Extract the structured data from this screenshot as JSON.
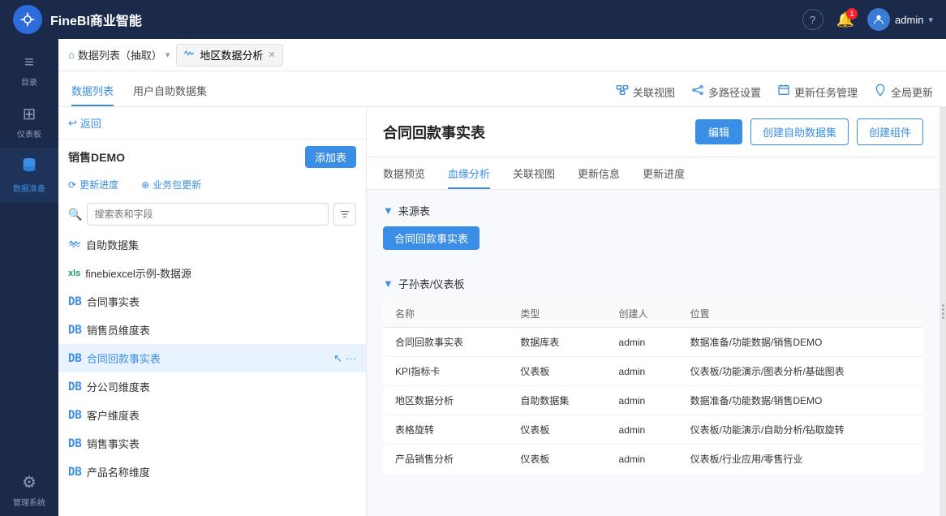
{
  "app": {
    "title": "FineBI商业智能",
    "logo_symbol": "⊕"
  },
  "topnav": {
    "help_icon": "?",
    "notif_count": "1",
    "admin_label": "admin",
    "admin_arrow": "▾"
  },
  "breadcrumb": {
    "home_icon": "⌂",
    "home_label": "数据列表（抽取）",
    "dropdown_icon": "▾",
    "wave_icon": "∿",
    "tab_label": "地区数据分析",
    "close_icon": "✕"
  },
  "sub_tabs": [
    {
      "label": "数据列表",
      "active": true
    },
    {
      "label": "用户自助数据集",
      "active": false
    }
  ],
  "sub_actions": [
    {
      "icon": "📊",
      "label": "关联视图"
    },
    {
      "icon": "⑆",
      "label": "多路径设置"
    },
    {
      "icon": "☁",
      "label": "更新任务管理"
    },
    {
      "icon": "☁",
      "label": "全局更新"
    }
  ],
  "left_panel": {
    "back_label": "↩ 返回",
    "demo_title": "销售DEMO",
    "add_btn_label": "添加表",
    "update_progress_icon": "⟳",
    "update_progress_label": "更新进度",
    "biz_update_icon": "+",
    "biz_update_label": "业务包更新",
    "search_placeholder": "搜索表和字段",
    "tree_items": [
      {
        "type": "self",
        "icon": "∿∿",
        "label": "自助数据集",
        "active": false
      },
      {
        "type": "xls",
        "icon": "xls",
        "label": "finebiexcel示例-数据源",
        "active": false
      },
      {
        "type": "db",
        "icon": "DB",
        "label": "合同事实表",
        "active": false
      },
      {
        "type": "db",
        "icon": "DB",
        "label": "销售员维度表",
        "active": false
      },
      {
        "type": "db",
        "icon": "DB",
        "label": "合同回款事实表",
        "active": true
      },
      {
        "type": "db",
        "icon": "DB",
        "label": "分公司维度表",
        "active": false
      },
      {
        "type": "db",
        "icon": "DB",
        "label": "客户维度表",
        "active": false
      },
      {
        "type": "db",
        "icon": "DB",
        "label": "销售事实表",
        "active": false
      },
      {
        "type": "db",
        "icon": "DB",
        "label": "产品名称维度",
        "active": false
      }
    ]
  },
  "right_panel": {
    "title": "合同回款事实表",
    "edit_btn": "编辑",
    "create_self_btn": "创建自助数据集",
    "create_component_btn": "创建组件",
    "content_tabs": [
      {
        "label": "数据预览",
        "active": false
      },
      {
        "label": "血缘分析",
        "active": true
      },
      {
        "label": "关联视图",
        "active": false
      },
      {
        "label": "更新信息",
        "active": false
      },
      {
        "label": "更新进度",
        "active": false
      }
    ],
    "source_section_label": "来源表",
    "source_toggle": "▼",
    "source_box_label": "合同回款事实表",
    "children_section_label": "子孙表/仪表板",
    "children_toggle": "▼",
    "table_headers": [
      "名称",
      "类型",
      "创建人",
      "位置"
    ],
    "table_rows": [
      {
        "name": "合同回款事实表",
        "type": "数据库表",
        "creator": "admin",
        "location": "数据准备/功能数据/销售DEMO"
      },
      {
        "name": "KPI指标卡",
        "type": "仪表板",
        "creator": "admin",
        "location": "仪表板/功能演示/图表分析/基础图表"
      },
      {
        "name": "地区数据分析",
        "type": "自助数据集",
        "creator": "admin",
        "location": "数据准备/功能数据/销售DEMO"
      },
      {
        "name": "表格旋转",
        "type": "仪表板",
        "creator": "admin",
        "location": "仪表板/功能演示/自助分析/钻取旋转"
      },
      {
        "name": "产品销售分析",
        "type": "仪表板",
        "creator": "admin",
        "location": "仪表板/行业应用/零售行业"
      }
    ]
  },
  "icon_sidebar": [
    {
      "icon": "≡",
      "label": "目录",
      "active": false
    },
    {
      "icon": "⊞",
      "label": "仪表板",
      "active": false
    },
    {
      "icon": "◉",
      "label": "数据准备",
      "active": true
    },
    {
      "icon": "⚙",
      "label": "管理系统",
      "active": false
    }
  ]
}
